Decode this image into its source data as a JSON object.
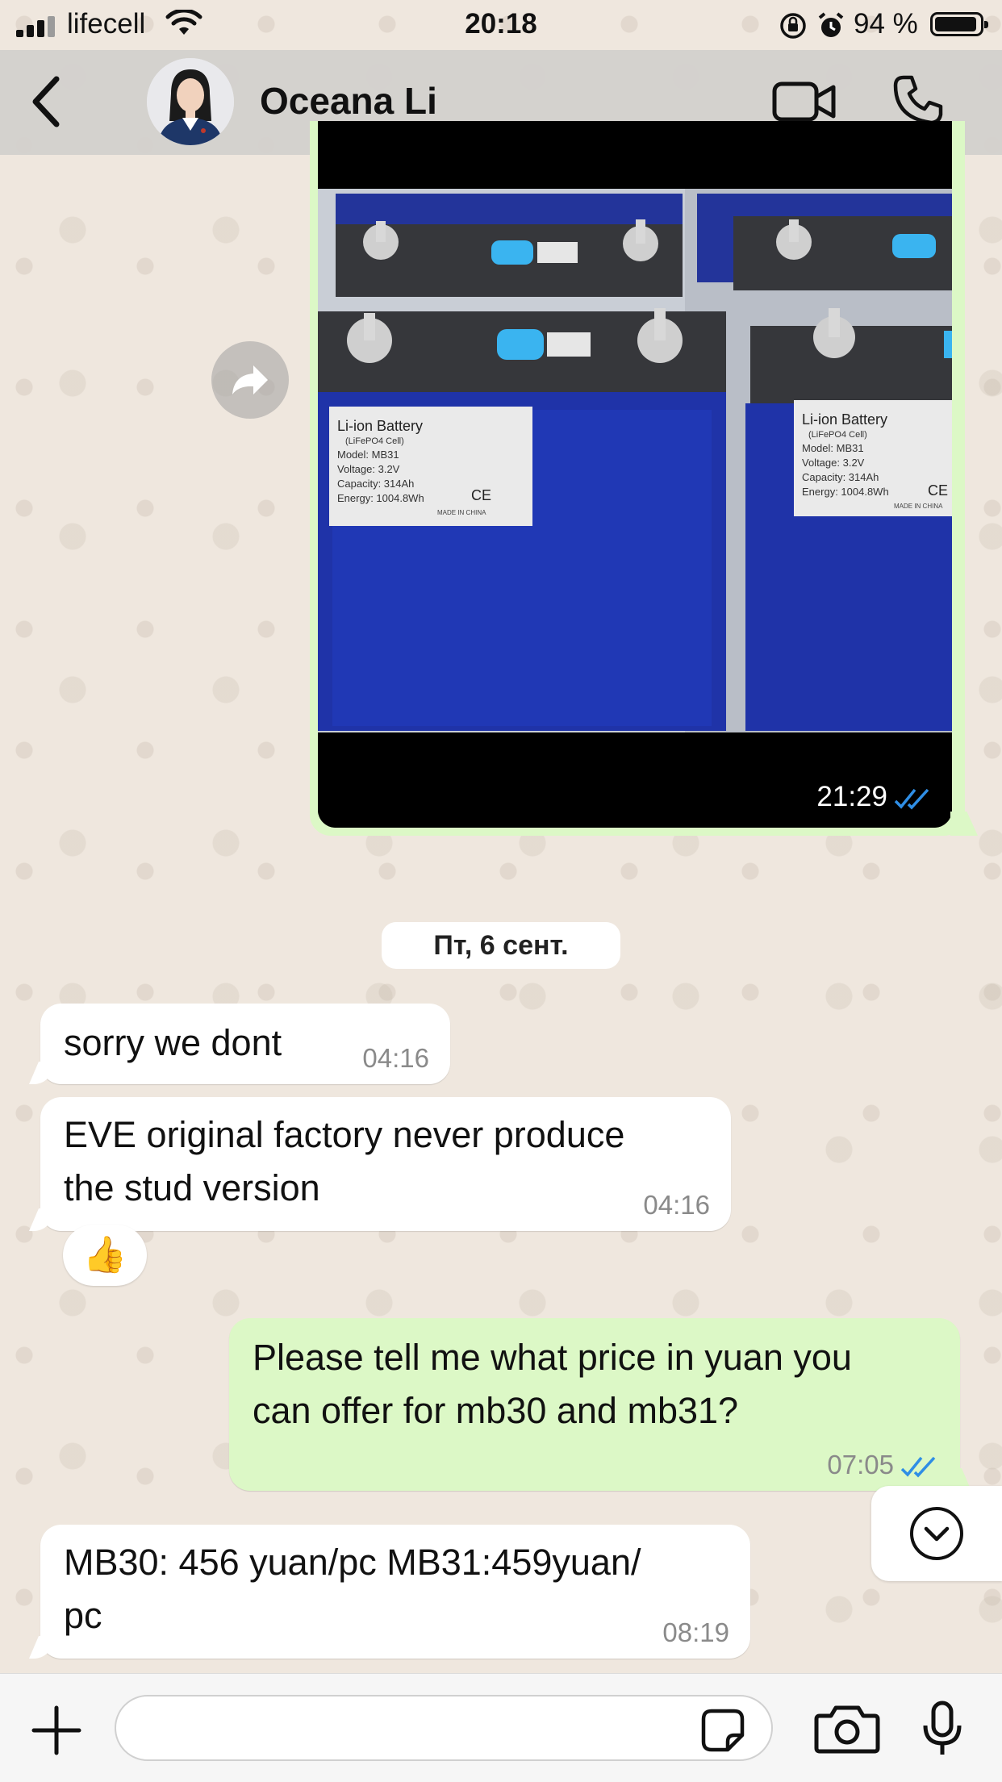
{
  "status_bar": {
    "carrier": "lifecell",
    "time": "20:18",
    "battery_percent": "94 %",
    "battery_level": 0.94,
    "signal_bars": 3
  },
  "header": {
    "contact_name": "Oceana Li"
  },
  "media_message": {
    "time": "21:29",
    "status": "read",
    "battery_labels": [
      {
        "title": "Li-ion Battery",
        "lines": [
          "(LiFePO4 Cell)",
          "Model: MB31",
          "Voltage: 3.2V",
          "Capacity: 314Ah",
          "Energy: 1004.8Wh"
        ],
        "mark": "CE",
        "origin": "MADE IN CHINA"
      },
      {
        "title": "Li-ion Battery",
        "lines": [
          "(LiFePO4 Cell)",
          "Model: MB31",
          "Voltage: 3.2V",
          "Capacity: 314Ah",
          "Energy: 1004.8Wh"
        ],
        "mark": "CE",
        "origin": "MADE IN CHINA"
      }
    ]
  },
  "date_separator": "Пт, 6 сент.",
  "messages": [
    {
      "direction": "in",
      "text": "sorry we dont",
      "time": "04:16"
    },
    {
      "direction": "in",
      "text_lines": [
        "EVE original factory never produce",
        "the stud version"
      ],
      "time": "04:16",
      "reaction": "👍"
    },
    {
      "direction": "out",
      "text_lines": [
        "Please tell me what price in yuan you",
        "can offer for mb30 and mb31?"
      ],
      "time": "07:05",
      "status": "read"
    },
    {
      "direction": "in",
      "text_lines": [
        "MB30: 456 yuan/pc MB31:459yuan/",
        "pc"
      ],
      "time": "08:19"
    }
  ],
  "colors": {
    "outgoing_bubble": "#dcf8c6",
    "incoming_bubble": "#ffffff",
    "read_ticks": "#2f8ee5",
    "chat_background": "#efe7de"
  },
  "icons": [
    "back-icon",
    "video-call-icon",
    "phone-icon",
    "forward-icon",
    "chevron-down-icon",
    "plus-icon",
    "sticker-icon",
    "camera-icon",
    "microphone-icon",
    "wifi-icon",
    "orientation-lock-icon",
    "alarm-icon",
    "battery-icon"
  ]
}
